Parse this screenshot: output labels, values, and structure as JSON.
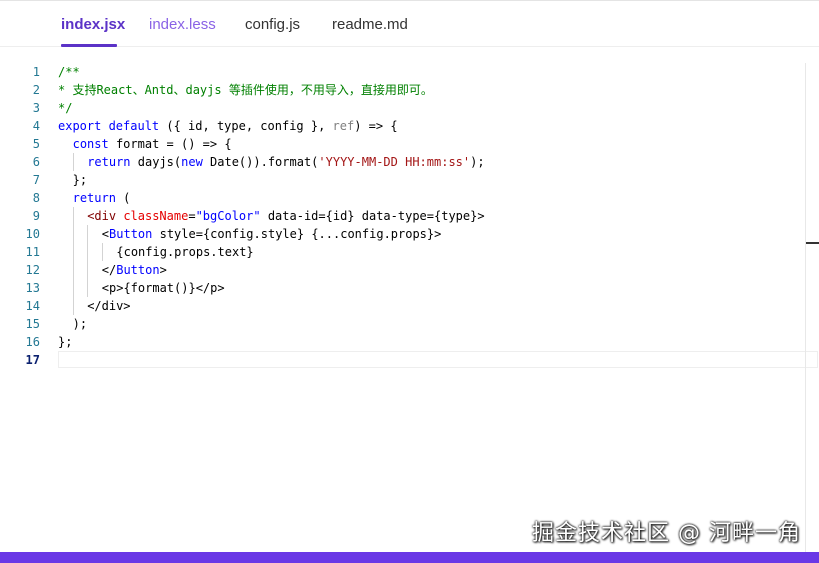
{
  "tabs": [
    {
      "label": "index.jsx",
      "active": true
    },
    {
      "label": "index.less",
      "active": false
    },
    {
      "label": "config.js",
      "active": false
    },
    {
      "label": "readme.md",
      "active": false
    }
  ],
  "editor": {
    "line_numbers": [
      "1",
      "2",
      "3",
      "4",
      "5",
      "6",
      "7",
      "8",
      "9",
      "10",
      "11",
      "12",
      "13",
      "14",
      "15",
      "16",
      "17"
    ],
    "current_line": "17",
    "code": {
      "l1": "/**",
      "l2": "* 支持React、Antd、dayjs 等插件使用，不用导入，直接用即可。",
      "l3": "*/",
      "l4_kw": "export default",
      "l4_rest": " ({ id, type, config }, ",
      "l4_ref": "ref",
      "l4_end": ") => {",
      "l5_kw": "const",
      "l5_rest": " format = () => {",
      "l6_kw": "return",
      "l6_a": " dayjs(",
      "l6_new": "new",
      "l6_b": " Date()).format(",
      "l6_str": "'YYYY-MM-DD HH:mm:ss'",
      "l6_c": ");",
      "l7": "};",
      "l8_kw": "return",
      "l8_rest": " (",
      "l9_a": "<div ",
      "l9_attr1": "className",
      "l9_eq": "=",
      "l9_str": "\"bgColor\"",
      "l9_b": " data-id={id} data-type={type}>",
      "l10_a": "<",
      "l10_comp": "Button",
      "l10_b": " style={config.style} {...config.props}>",
      "l11": "{config.props.text}",
      "l12_a": "</",
      "l12_comp": "Button",
      "l12_b": ">",
      "l13": "<p>{format()}</p>",
      "l14": "</div>",
      "l15": ");",
      "l16": "};",
      "l17": ""
    }
  },
  "watermark": "掘金技术社区 @ 河畔一角",
  "colors": {
    "accent": "#5b32c7",
    "bottom_bar": "#6a38e6",
    "keyword": "#0000ff",
    "comment": "#008000",
    "string": "#a31515",
    "line_number": "#237893"
  }
}
